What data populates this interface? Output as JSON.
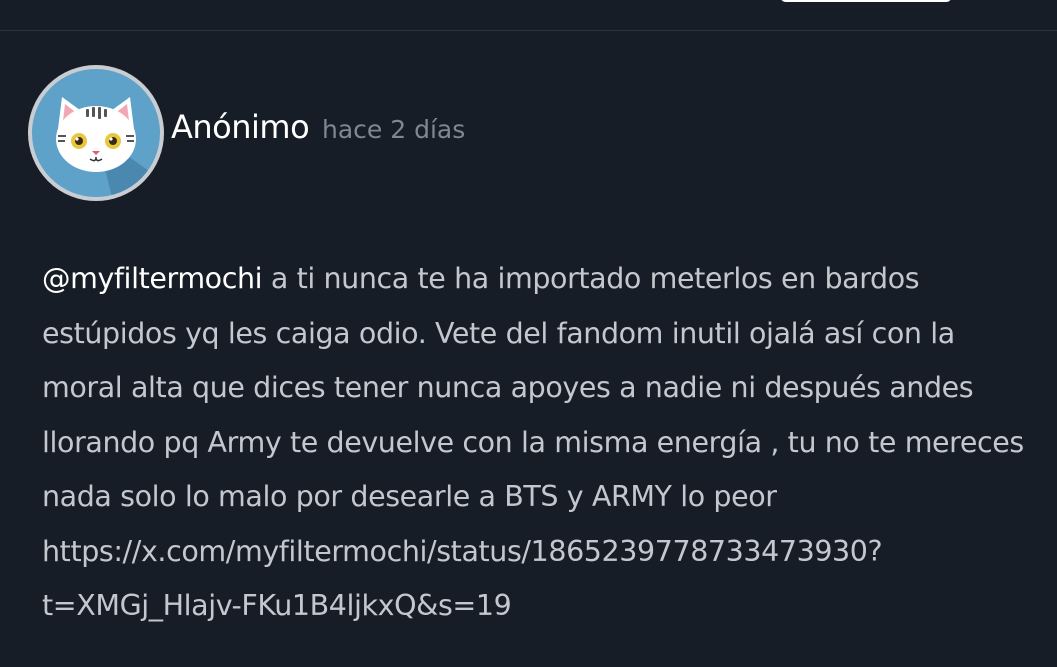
{
  "post": {
    "author": "Anónimo",
    "time": "hace 2 días",
    "mention": "@myfiltermochi",
    "body": " a ti nunca te ha importado meterlos en bardos estúpidos yq les caiga odio. Vete del fandom inutil ojalá así con la moral alta que dices tener nunca apoyes a nadie ni después andes llorando pq Army te devuelve con la misma energía , tu no te mereces nada solo lo malo por desearle a BTS y ARMY lo peor ",
    "link_line1": "https://x.com/myfiltermochi/status/1865239778733473930?",
    "link_line2": "t=XMGj_Hlajv-FKu1B4ljkxQ&s=19",
    "avatar_icon": "white-cat-avatar-icon"
  },
  "colors": {
    "background": "#171d26",
    "author": "#ffffff",
    "timestamp": "#7d8895",
    "body_text": "#c3c8ce",
    "avatar_bg": "#5ea1c9"
  }
}
